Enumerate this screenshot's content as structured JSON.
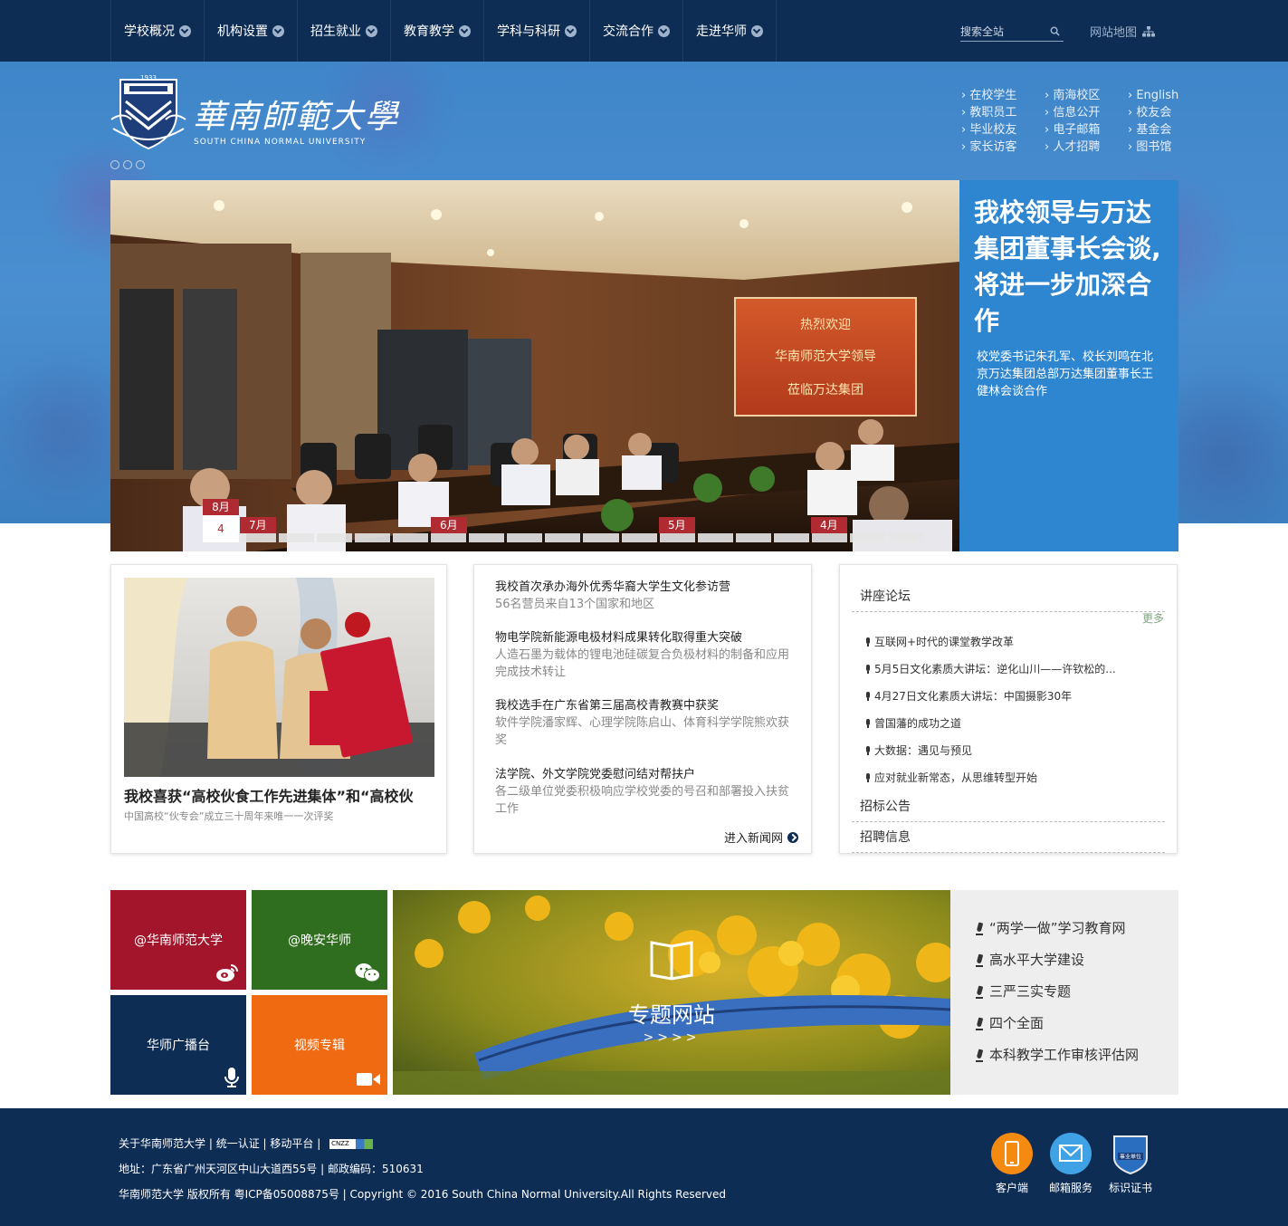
{
  "nav": {
    "items": [
      "学校概况",
      "机构设置",
      "招生就业",
      "教育教学",
      "学科与科研",
      "交流合作",
      "走进华师"
    ],
    "search_placeholder": "搜索全站",
    "sitemap": "网站地图"
  },
  "logo": {
    "cn": "華南師範大學",
    "en": "SOUTH CHINA NORMAL UNIVERSITY",
    "year": "1933"
  },
  "quicklinks": [
    "在校学生",
    "南海校区",
    "English",
    "教职员工",
    "信息公开",
    "校友会",
    "毕业校友",
    "电子邮箱",
    "基金会",
    "家长访客",
    "人才招聘",
    "图书馆"
  ],
  "slider": {
    "title": "我校领导与万达集团董事长会谈,将进一步加深合作",
    "desc": "校党委书记朱孔军、校长刘鸣在北京万达集团总部万达集团董事长王健林会谈合作",
    "banner_lines": [
      "热烈欢迎",
      "华南师范大学领导",
      "莅临万达集团"
    ],
    "active_month": "8月",
    "active_day": "4",
    "months": [
      "7月",
      "6月",
      "5月",
      "4月"
    ]
  },
  "feature": {
    "title": "我校喜获“高校伙食工作先进集体”和“高校伙",
    "sub": "中国高校“伙专会”成立三十周年来唯一一次评奖"
  },
  "news": [
    {
      "title": "我校首次承办海外优秀华裔大学生文化参访营",
      "sub": "56名营员来自13个国家和地区"
    },
    {
      "title": "物电学院新能源电极材料成果转化取得重大突破",
      "sub": "人造石墨为载体的锂电池硅碳复合负极材料的制备和应用完成技术转让"
    },
    {
      "title": "我校选手在广东省第三届高校青教赛中获奖",
      "sub": "软件学院潘家辉、心理学院陈启山、体育科学学院熊欢获奖"
    },
    {
      "title": "法学院、外文学院党委慰问结对帮扶户",
      "sub": "各二级单位党委积极响应学校党委的号召和部署投入扶贫工作"
    }
  ],
  "enter_news": "进入新闻网",
  "lectures": {
    "header": "讲座论坛",
    "more": "更多",
    "items": [
      "互联网+时代的课堂教学改革",
      "5月5日文化素质大讲坛：逆化山川——许钦松的...",
      "4月27日文化素质大讲坛：中国摄影30年",
      "曾国藩的成功之道",
      "大数据：遇见与预见",
      "应对就业新常态，从思维转型开始"
    ],
    "bid": "招标公告",
    "recruit": "招聘信息"
  },
  "tiles": {
    "weibo": "@华南师范大学",
    "wechat": "@晚安华师",
    "radio": "华师广播台",
    "video": "视频专辑"
  },
  "topic": {
    "label": "专题网站",
    "arrows": ">>>>",
    "links": [
      "“两学一做”学习教育网",
      "高水平大学建设",
      "三严三实专题",
      "四个全面",
      "本科教学工作审核评估网"
    ]
  },
  "footer": {
    "links": [
      "关于华南师范大学",
      "统一认证",
      "移动平台"
    ],
    "cnzz": "CNZZ",
    "address": "地址：广东省广州天河区中山大道西55号 | 邮政编码：510631",
    "copyright": "华南师范大学 版权所有 粤ICP备05008875号 | Copyright © 2016 South China Normal University.All Rights Reserved",
    "buttons": [
      "客户端",
      "邮箱服务",
      "标识证书"
    ],
    "badge": "事业单位"
  },
  "colors": {
    "navy": "#0e2d55",
    "accent_blue": "#2f86d0",
    "crimson": "#b02a31",
    "tile_red": "#a3152b",
    "tile_green": "#2f6d1f",
    "tile_orange": "#f06a12"
  }
}
